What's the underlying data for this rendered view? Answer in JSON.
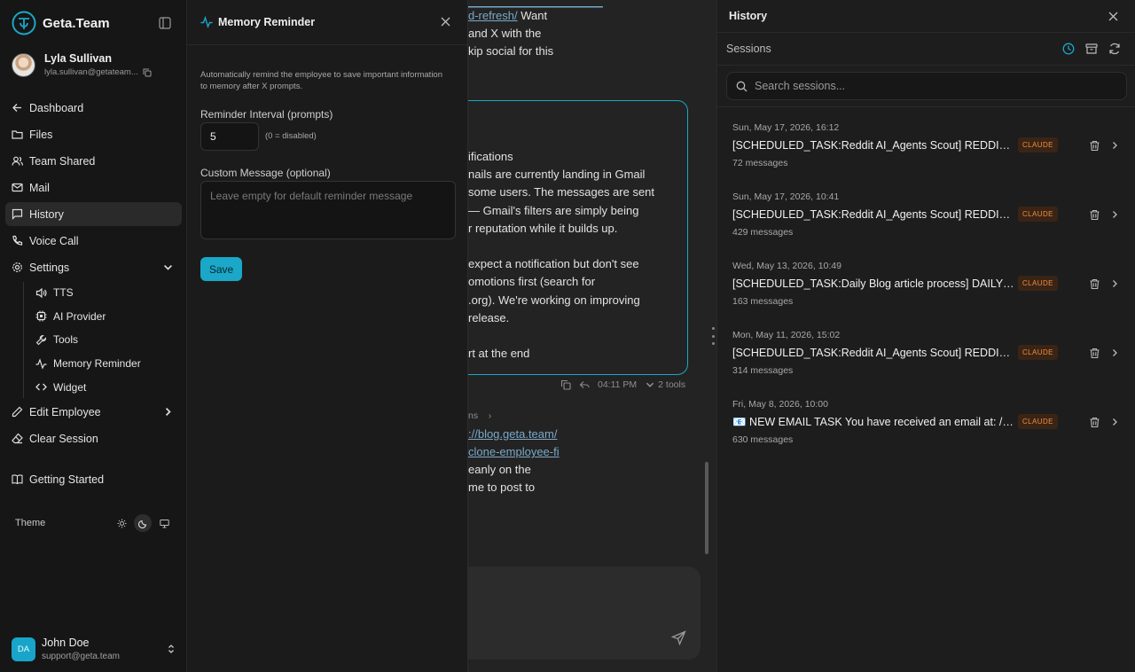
{
  "brand": {
    "name": "Geta.Team"
  },
  "user": {
    "name": "Lyla Sullivan",
    "email": "lyla.sullivan@getateam..."
  },
  "nav": {
    "dashboard": "Dashboard",
    "files": "Files",
    "team_shared": "Team Shared",
    "mail": "Mail",
    "history": "History",
    "voice_call": "Voice Call",
    "settings": "Settings",
    "tts": "TTS",
    "ai_provider": "AI Provider",
    "tools": "Tools",
    "memory_reminder": "Memory Reminder",
    "widget": "Widget",
    "edit_employee": "Edit Employee",
    "clear_session": "Clear Session",
    "getting_started": "Getting Started"
  },
  "theme": {
    "label": "Theme",
    "selected": "dark"
  },
  "account": {
    "initials": "DA",
    "name": "John Doe",
    "email": "support@geta.team"
  },
  "memory_panel": {
    "title": "Memory Reminder",
    "description": "Automatically remind the employee to save important information to memory after X prompts.",
    "interval_label": "Reminder Interval (prompts)",
    "interval_value": "5",
    "interval_hint": "(0 = disabled)",
    "message_label": "Custom Message (optional)",
    "message_placeholder": "Leave empty for default reminder message",
    "save_label": "Save"
  },
  "chat": {
    "top_link_1": "d-refresh/",
    "top_text_1": " Want",
    "top_text_2": "and X with the",
    "top_text_3": "kip social for this",
    "lines": [
      "ifications",
      "nails are currently landing in Gmail",
      "some users. The messages are sent",
      "— Gmail's filters are simply being",
      "r reputation while it builds up.",
      "",
      "expect a notification but don't see",
      "omotions first (search for",
      ".org). We're working on improving",
      "release.",
      "",
      "rt at the end"
    ],
    "time": "04:11 PM",
    "tools": "2 tools",
    "crumb": "ns",
    "link_1": "://blog.geta.team/",
    "link_2": "clone-employee-fi",
    "text_1": "eanly on the",
    "text_2": "me to post to"
  },
  "history": {
    "title": "History",
    "sessions_label": "Sessions",
    "search_placeholder": "Search sessions...",
    "accent": "#1ba7c8",
    "items": [
      {
        "date": "Sun, May 17, 2026, 16:12",
        "title": "[SCHEDULED_TASK:Reddit AI_Agents Scout] REDDIT SCOUT",
        "badge": "CLAUDE",
        "count": "72 messages"
      },
      {
        "date": "Sun, May 17, 2026, 10:41",
        "title": "[SCHEDULED_TASK:Reddit AI_Agents Scout] REDDIT SCOUT",
        "badge": "CLAUDE",
        "count": "429 messages"
      },
      {
        "date": "Wed, May 13, 2026, 10:49",
        "title": "[SCHEDULED_TASK:Daily Blog article process] DAILY BLOG",
        "badge": "CLAUDE",
        "count": "163 messages"
      },
      {
        "date": "Mon, May 11, 2026, 15:02",
        "title": "[SCHEDULED_TASK:Reddit AI_Agents Scout] REDDIT SCOUT",
        "badge": "CLAUDE",
        "count": "314 messages"
      },
      {
        "date": "Fri, May 8, 2026, 10:00",
        "title": "📧 NEW EMAIL TASK You have received an email at: /opt/",
        "badge": "CLAUDE",
        "count": "630 messages"
      }
    ]
  }
}
